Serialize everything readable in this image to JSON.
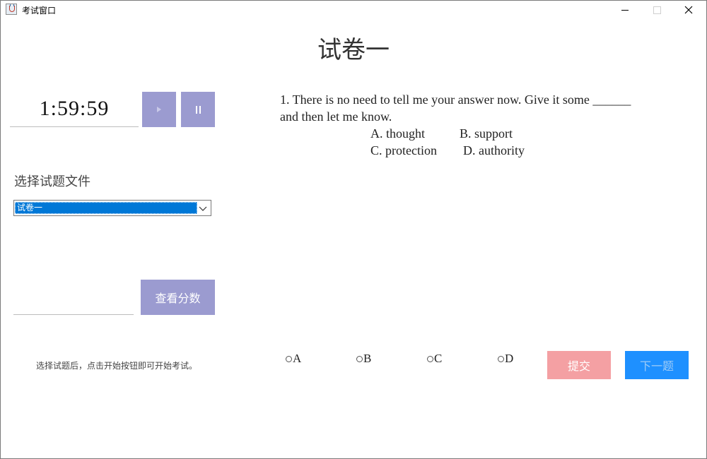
{
  "window": {
    "title": "考试窗口"
  },
  "exam": {
    "title": "试卷一"
  },
  "timer": {
    "display": "1:59:59",
    "start_label": ">",
    "pause_label": "II"
  },
  "file_select": {
    "label": "选择试题文件",
    "selected": "试卷一"
  },
  "score": {
    "field_value": "",
    "button_label": "查看分数"
  },
  "hint": "选择试题后，点击开始按钮即可开始考试。",
  "question": {
    "text": "1. There is no need to tell me your answer now. Give it some ______ and then let me know.",
    "options": {
      "a": "A. thought",
      "b": "B. support",
      "c": "C. protection",
      "d": "D. authority"
    }
  },
  "answers": {
    "a": "A",
    "b": "B",
    "c": "C",
    "d": "D"
  },
  "actions": {
    "submit": "提交",
    "next": "下一题"
  },
  "colors": {
    "control_button": "#9b9bd0",
    "submit_button": "#f4a0a3",
    "next_button": "#1e90ff",
    "selection_highlight": "#0078d7"
  }
}
